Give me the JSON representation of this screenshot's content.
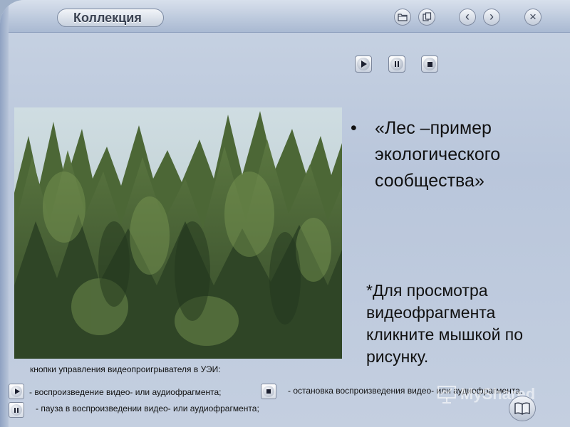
{
  "window": {
    "title": "Коллекция",
    "buttons": [
      {
        "name": "open-folder",
        "icon": "folder-icon"
      },
      {
        "name": "copy",
        "icon": "copy-icon"
      },
      {
        "name": "back",
        "icon": "chevron-left-icon",
        "glyph": "‹"
      },
      {
        "name": "forward",
        "icon": "chevron-right-icon",
        "glyph": "›"
      },
      {
        "name": "close",
        "icon": "close-icon",
        "glyph": "×"
      }
    ]
  },
  "player": {
    "buttons": [
      {
        "name": "play",
        "icon": "play-icon"
      },
      {
        "name": "pause",
        "icon": "pause-icon"
      },
      {
        "name": "stop",
        "icon": "stop-icon"
      }
    ]
  },
  "content": {
    "bullet": "•",
    "heading": "«Лес –пример экологического сообщества»",
    "note": "*Для просмотра видеофрагмента кликните мышкой по рисунку."
  },
  "legend": {
    "title": "кнопки управления видеопроигрывателя в УЭИ:",
    "play_text": "- воспроизведение видео- или аудиофрагмента;",
    "stop_text": "- остановка воспроизведения видео- или аудиофрагмента.",
    "pause_text": "- пауза в воспроизведении видео- или аудиофрагмента;"
  },
  "watermark": {
    "text": "MyShared"
  },
  "colors": {
    "frame": "#b9c6db",
    "title_text": "#3a4252",
    "forest_dark": "#2f4526",
    "forest_light": "#6f8a4c",
    "sky": "#c9d8de"
  }
}
